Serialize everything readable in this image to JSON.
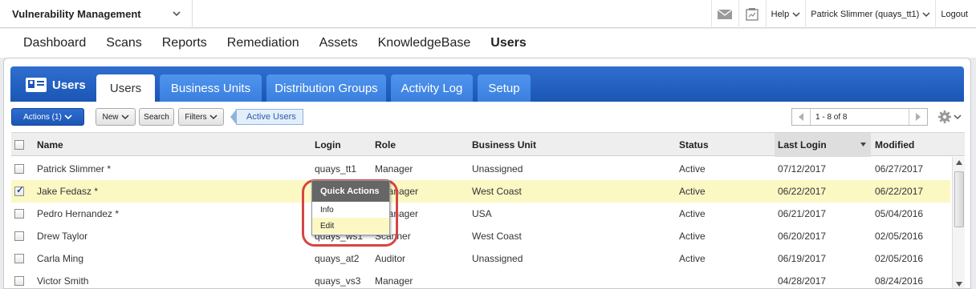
{
  "header": {
    "app_title": "Vulnerability Management",
    "help_label": "Help",
    "user_label": "Patrick Slimmer (quays_tt1)",
    "logout_label": "Logout"
  },
  "nav": {
    "items": [
      "Dashboard",
      "Scans",
      "Reports",
      "Remediation",
      "Assets",
      "KnowledgeBase",
      "Users"
    ],
    "active": "Users"
  },
  "module": {
    "title": "Users",
    "tabs": [
      "Users",
      "Business Units",
      "Distribution Groups",
      "Activity Log",
      "Setup"
    ]
  },
  "toolbar": {
    "actions_label": "Actions (1)",
    "new_label": "New",
    "search_label": "Search",
    "filters_label": "Filters",
    "filter_tag": "Active Users",
    "pager_info": "1 - 8 of 8"
  },
  "table": {
    "columns": [
      "Name",
      "Login",
      "Role",
      "Business Unit",
      "Status",
      "Last Login",
      "Modified"
    ],
    "rows": [
      {
        "name": "Patrick Slimmer *",
        "login": "quays_tt1",
        "role": "Manager",
        "bu": "Unassigned",
        "status": "Active",
        "last": "07/12/2017",
        "mod": "06/27/2017",
        "checked": false
      },
      {
        "name": "Jake Fedasz *",
        "login": "",
        "role": "t Manager",
        "bu": "West Coast",
        "status": "Active",
        "last": "06/22/2017",
        "mod": "06/22/2017",
        "checked": true
      },
      {
        "name": "Pedro Hernandez *",
        "login": "",
        "role": "t Manager",
        "bu": "USA",
        "status": "Active",
        "last": "06/21/2017",
        "mod": "05/04/2016",
        "checked": false
      },
      {
        "name": "Drew Taylor",
        "login": "quays_ws1",
        "role": "Scanner",
        "bu": "West Coast",
        "status": "Active",
        "last": "06/20/2017",
        "mod": "02/05/2016",
        "checked": false
      },
      {
        "name": "Carla Ming",
        "login": "quays_at2",
        "role": "Auditor",
        "bu": "Unassigned",
        "status": "Active",
        "last": "06/19/2017",
        "mod": "02/05/2016",
        "checked": false
      },
      {
        "name": "Victor Smith",
        "login": "quays_vs3",
        "role": "Manager",
        "bu": "",
        "status": "",
        "last": "04/28/2017",
        "mod": "08/24/2016",
        "checked": false
      }
    ]
  },
  "quick_actions": {
    "title": "Quick Actions",
    "items": [
      "Info",
      "Edit"
    ]
  }
}
